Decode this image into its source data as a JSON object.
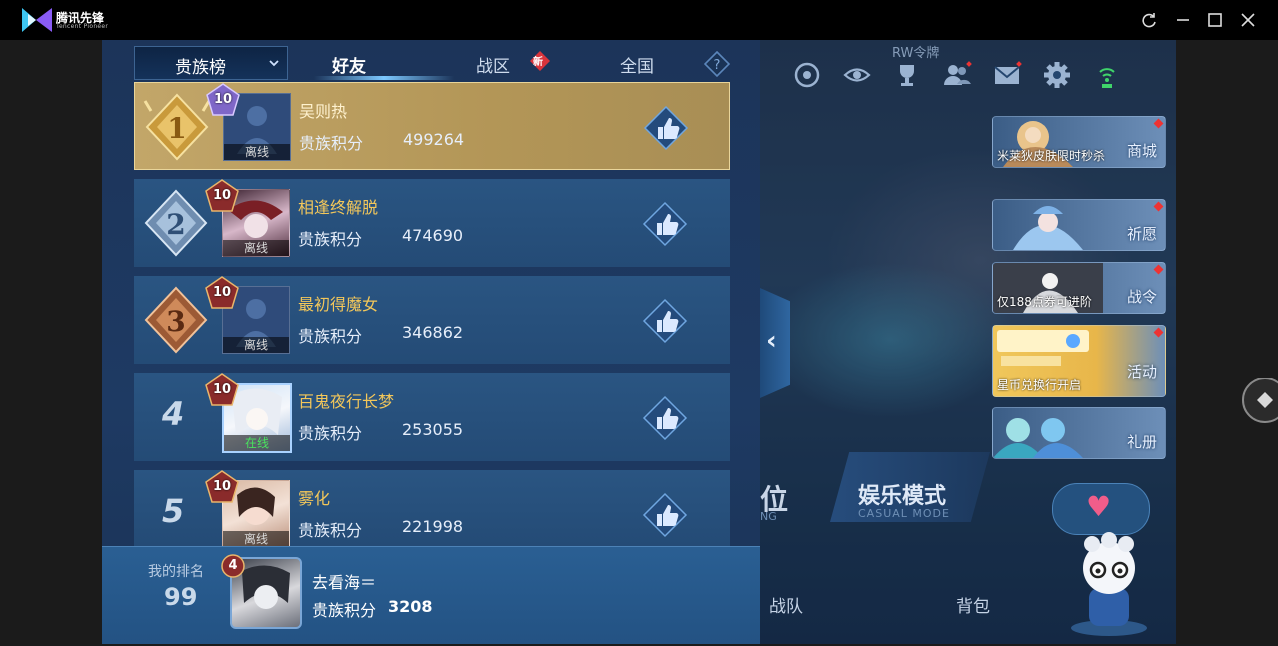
{
  "app": {
    "name": "腾讯先锋",
    "subtitle": "Tencent Pioneer",
    "window_controls": [
      "refresh-icon",
      "minimize-icon",
      "maximize-icon",
      "close-icon"
    ]
  },
  "leaderboard": {
    "dropdown_label": "贵族榜",
    "tabs": [
      {
        "label": "好友",
        "active": true
      },
      {
        "label": "战区",
        "badge": "新"
      },
      {
        "label": "全国"
      }
    ],
    "rows": [
      {
        "rank": "1",
        "name": "吴则热",
        "score_label": "贵族积分",
        "score": "499264",
        "level": "10",
        "status": "离线"
      },
      {
        "rank": "2",
        "name": "相逢终解脱",
        "score_label": "贵族积分",
        "score": "474690",
        "level": "10",
        "status": "离线"
      },
      {
        "rank": "3",
        "name": "最初得魔女",
        "score_label": "贵族积分",
        "score": "346862",
        "level": "10",
        "status": "离线"
      },
      {
        "rank": "4",
        "name": "百鬼夜行长梦",
        "score_label": "贵族积分",
        "score": "253055",
        "level": "10",
        "status": "在线"
      },
      {
        "rank": "5",
        "name": "雾化",
        "score_label": "贵族积分",
        "score": "221998",
        "level": "10",
        "status": "离线"
      }
    ],
    "mine": {
      "label": "我的排名",
      "rank": "99",
      "level": "4",
      "name": "去看海＝",
      "score_label": "贵族积分",
      "score": "3208"
    }
  },
  "lobby": {
    "rw_tag": "RW令牌",
    "side_cards": [
      {
        "caption": "米莱狄皮肤限时秒杀",
        "label": "商城"
      },
      {
        "caption": "",
        "label": "祈愿"
      },
      {
        "caption": "仅188点券可进阶",
        "label": "战令"
      },
      {
        "caption": "星币兑换行开启",
        "label": "活动"
      },
      {
        "caption": "",
        "label": "礼册"
      }
    ],
    "mode_left": {
      "title": "位",
      "sub": "NG"
    },
    "mode": {
      "title": "娱乐模式",
      "sub": "CASUAL MODE"
    },
    "bottom": {
      "team": "战队",
      "bag": "背包"
    }
  },
  "colors": {
    "gold": "#f3c75a",
    "online": "#49e35e",
    "accent": "#7cc8ff"
  }
}
